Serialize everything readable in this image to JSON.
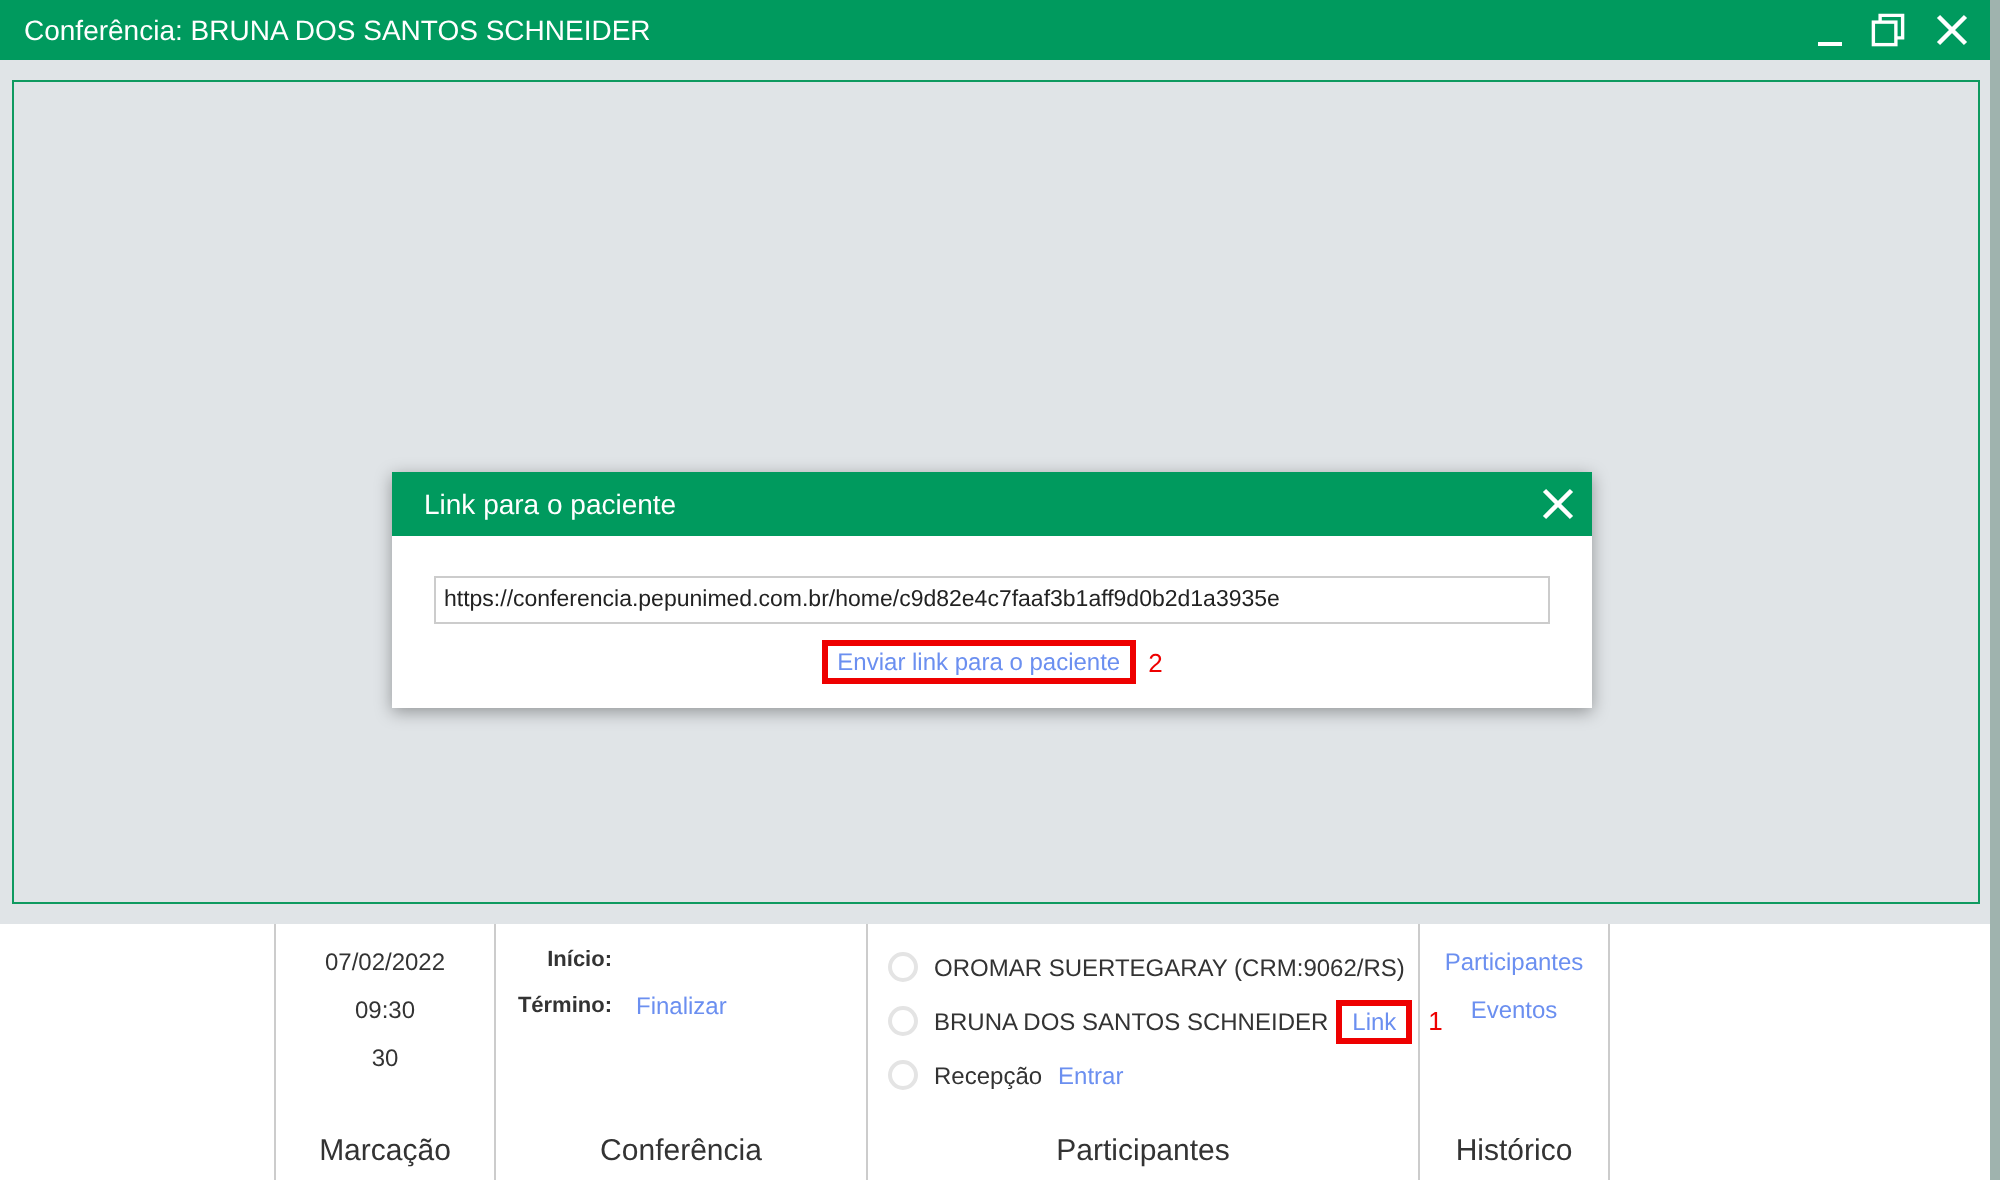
{
  "window": {
    "title": "Conferência: BRUNA DOS SANTOS SCHNEIDER"
  },
  "dialog": {
    "title": "Link para o paciente",
    "url": "https://conferencia.pepunimed.com.br/home/c9d82e4c7faaf3b1aff9d0b2d1a3935e",
    "send_link": "Enviar link para o paciente",
    "send_link_marker": "2"
  },
  "marcacao": {
    "date": "07/02/2022",
    "time": "09:30",
    "duration": "30",
    "heading": "Marcação"
  },
  "conferencia": {
    "start_label": "Início:",
    "end_label": "Término:",
    "end_action": "Finalizar",
    "heading": "Conferência"
  },
  "participantes": {
    "heading": "Participantes",
    "items": [
      {
        "name": "OROMAR SUERTEGARAY (CRM:9062/RS)",
        "selected": false
      },
      {
        "name": "BRUNA DOS SANTOS SCHNEIDER",
        "selected": false,
        "action": "Link",
        "marker": "1"
      },
      {
        "name": "Recepção",
        "selected": false,
        "action": "Entrar"
      }
    ]
  },
  "historico": {
    "heading": "Histórico",
    "links": [
      "Participantes",
      "Eventos"
    ]
  }
}
